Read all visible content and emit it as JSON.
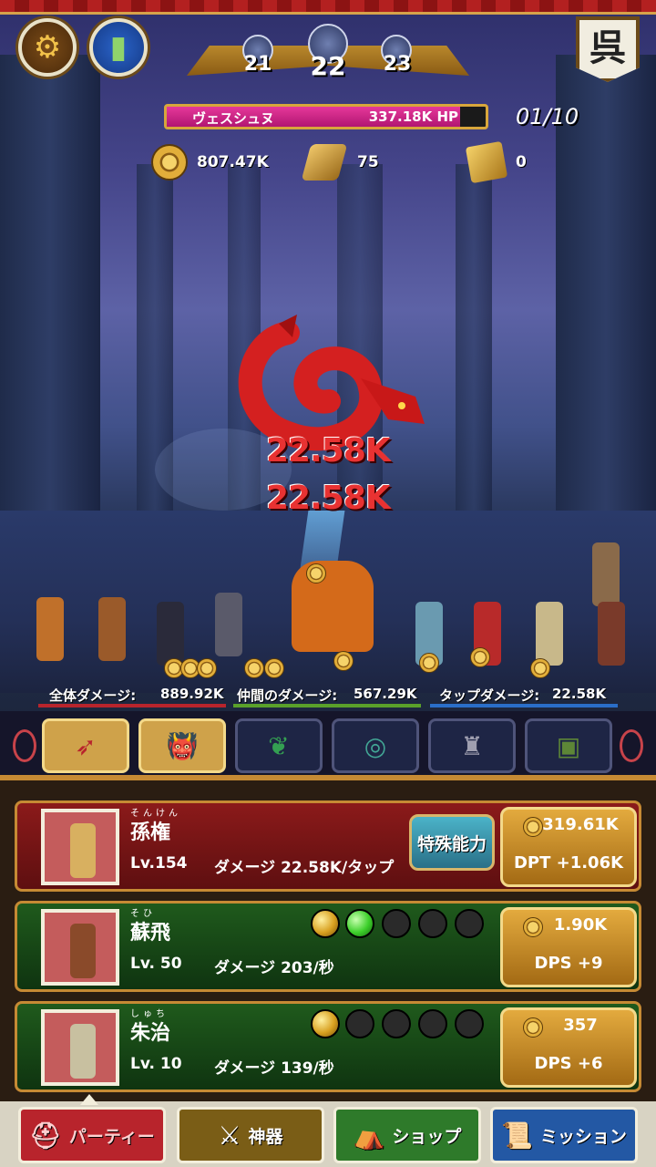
{
  "stages": {
    "prev": "21",
    "current": "22",
    "next": "23"
  },
  "boss": {
    "name": "ヴェスシュヌ",
    "hp": "337.18K HP",
    "hp_fraction": 0.92
  },
  "wave": "01/10",
  "currencies": {
    "gold": "807.47K",
    "ingot": "75",
    "ticket": "0"
  },
  "floating_damage": [
    "22.58K",
    "22.58K"
  ],
  "damage_stats": {
    "total_label": "全体ダメージ:",
    "total_value": "889.92K",
    "ally_label": "仲間のダメージ:",
    "ally_value": "567.29K",
    "tap_label": "タップダメージ:",
    "tap_value": "22.58K"
  },
  "flag_glyph": "呉",
  "categories": [
    {
      "icon": "quiver-icon",
      "glyph": "➶",
      "active": true
    },
    {
      "icon": "demon-icon",
      "glyph": "👹",
      "active": true
    },
    {
      "icon": "branch-icon",
      "glyph": "❦",
      "active": false
    },
    {
      "icon": "orb-icon",
      "glyph": "◎",
      "active": false
    },
    {
      "icon": "statue-icon",
      "glyph": "♜",
      "active": false
    },
    {
      "icon": "chest-icon",
      "glyph": "▣",
      "active": false
    }
  ],
  "units": [
    {
      "ruby": "そんけん",
      "name": "孫権",
      "level": "Lv.154",
      "damage": "ダメージ 22.58K/タップ",
      "skill_label": "特殊能力",
      "cost": "319.61K",
      "gain": "DPT +1.06K",
      "theme": "red",
      "orbs": []
    },
    {
      "ruby": "そひ",
      "name": "蘇飛",
      "level": "Lv. 50",
      "damage": "ダメージ 203/秒",
      "cost": "1.90K",
      "gain": "DPS +9",
      "theme": "green",
      "orbs": [
        "gold",
        "green",
        "empty",
        "empty",
        "empty"
      ]
    },
    {
      "ruby": "しゅち",
      "name": "朱治",
      "level": "Lv. 10",
      "damage": "ダメージ 139/秒",
      "cost": "357",
      "gain": "DPS +6",
      "theme": "green",
      "orbs": [
        "gold",
        "empty",
        "empty",
        "empty",
        "empty"
      ]
    }
  ],
  "nav": {
    "party": "パーティー",
    "relic": "神器",
    "shop": "ショップ",
    "mission": "ミッション"
  },
  "colors": {
    "boss_hp": "#d81e80",
    "gold": "#e3aa3e",
    "tap_line": "#2a6ec8",
    "ally_line": "#5aa02a",
    "total_line": "#b8242c"
  }
}
